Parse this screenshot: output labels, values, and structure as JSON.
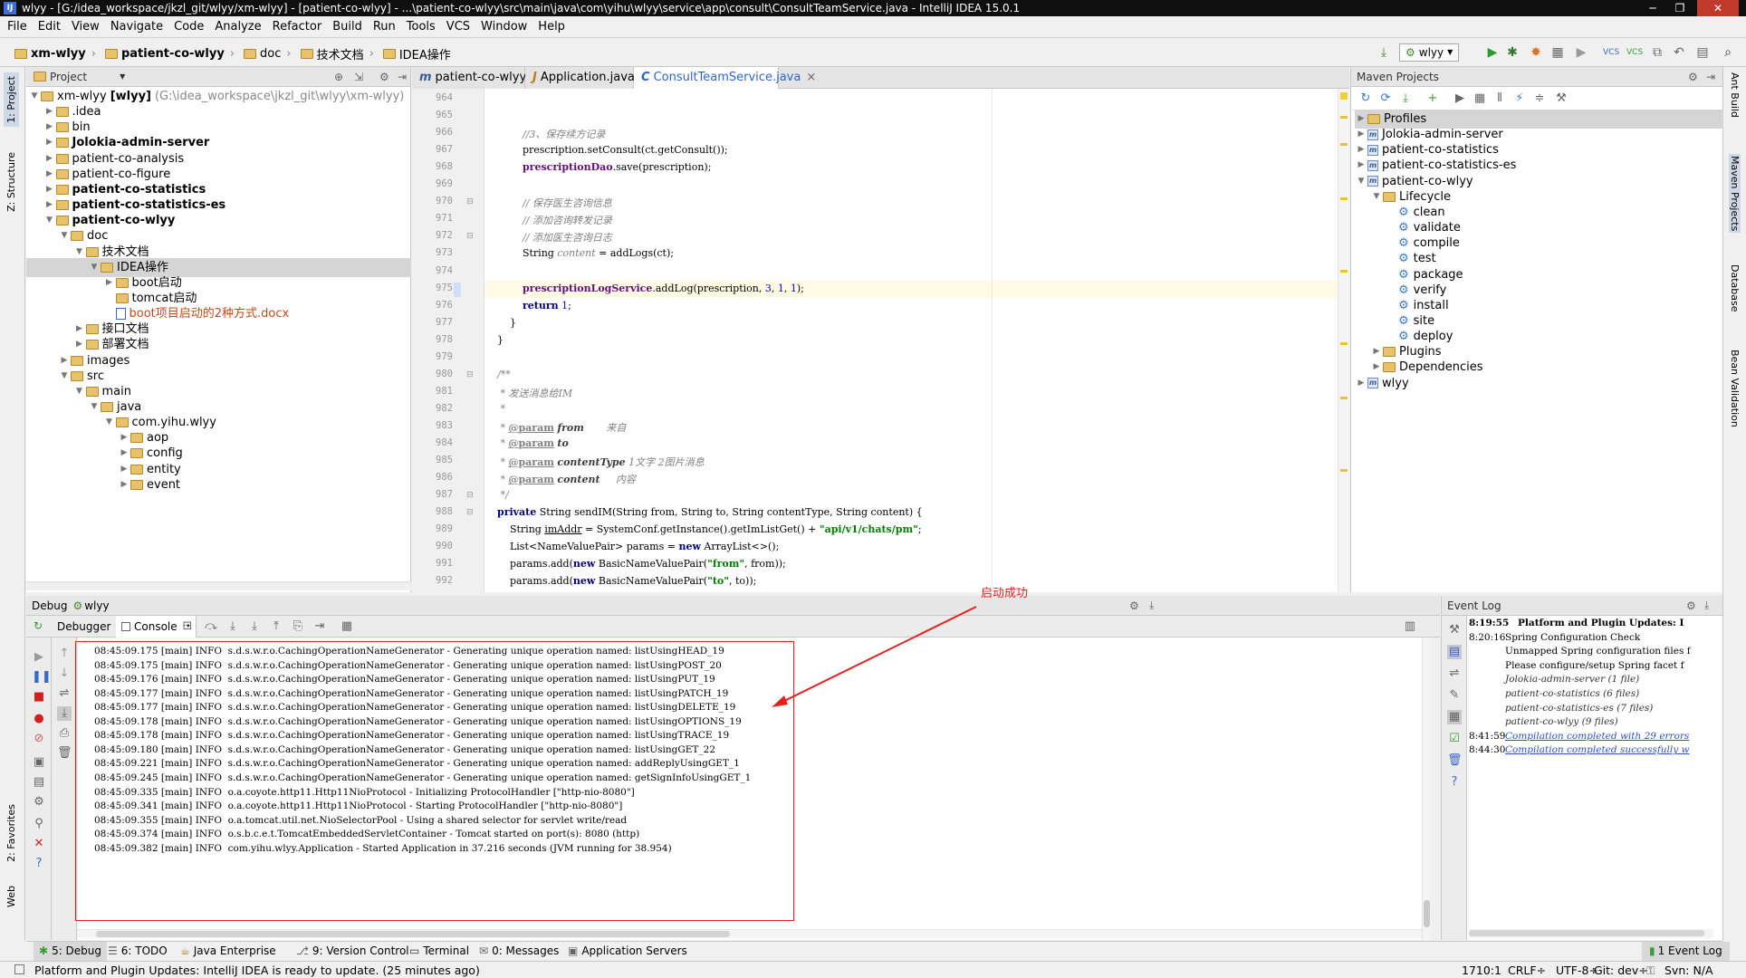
{
  "window": {
    "title": "wlyy - [G:/idea_workspace/jkzl_git/wlyy/xm-wlyy] - [patient-co-wlyy] - ...\\patient-co-wlyy\\src\\main\\java\\com\\yihu\\wlyy\\service\\app\\consult\\ConsultTeamService.java - IntelliJ IDEA 15.0.1",
    "logo": "IJ",
    "min": "─",
    "max": "❐",
    "close": "✕"
  },
  "menu": [
    "File",
    "Edit",
    "View",
    "Navigate",
    "Code",
    "Analyze",
    "Refactor",
    "Build",
    "Run",
    "Tools",
    "VCS",
    "Window",
    "Help"
  ],
  "breadcrumb": [
    "xm-wlyy",
    "patient-co-wlyy",
    "doc",
    "技术文档",
    "IDEA操作"
  ],
  "toolbar": {
    "run_config": "wlyy"
  },
  "left_strip": {
    "project": "1: Project",
    "structure": "Z: Structure",
    "favorites": "2: Favorites",
    "web": "Web"
  },
  "right_strip": {
    "ant": "Ant Build",
    "maven": "Maven Projects",
    "database": "Database",
    "bean": "Bean Validation"
  },
  "project_panel": {
    "title": "Project",
    "root": {
      "name": "xm-wlyy",
      "module": "[wlyy]",
      "path": "(G:\\idea_workspace\\jkzl_git\\wlyy\\xm-wlyy)"
    },
    "items": [
      {
        "label": ".idea",
        "depth": 1,
        "arrow": "▶",
        "bold": false
      },
      {
        "label": "bin",
        "depth": 1,
        "arrow": "▶",
        "bold": false
      },
      {
        "label": "Jolokia-admin-server",
        "depth": 1,
        "arrow": "▶",
        "bold": true
      },
      {
        "label": "patient-co-analysis",
        "depth": 1,
        "arrow": "▶",
        "bold": false
      },
      {
        "label": "patient-co-figure",
        "depth": 1,
        "arrow": "▶",
        "bold": false
      },
      {
        "label": "patient-co-statistics",
        "depth": 1,
        "arrow": "▶",
        "bold": true
      },
      {
        "label": "patient-co-statistics-es",
        "depth": 1,
        "arrow": "▶",
        "bold": true
      },
      {
        "label": "patient-co-wlyy",
        "depth": 1,
        "arrow": "▼",
        "bold": true
      },
      {
        "label": "doc",
        "depth": 2,
        "arrow": "▼",
        "bold": false
      },
      {
        "label": "技术文档",
        "depth": 3,
        "arrow": "▼",
        "bold": false
      },
      {
        "label": "IDEA操作",
        "depth": 4,
        "arrow": "▼",
        "bold": false,
        "selected": true
      },
      {
        "label": "boot启动",
        "depth": 5,
        "arrow": "▶",
        "bold": false
      },
      {
        "label": "tomcat启动",
        "depth": 5,
        "arrow": "",
        "bold": false
      },
      {
        "label": "boot项目启动的2种方式.docx",
        "depth": 5,
        "arrow": "",
        "bold": false,
        "file": true
      },
      {
        "label": "接口文档",
        "depth": 3,
        "arrow": "▶",
        "bold": false
      },
      {
        "label": "部署文档",
        "depth": 3,
        "arrow": "▶",
        "bold": false
      },
      {
        "label": "images",
        "depth": 2,
        "arrow": "▶",
        "bold": false
      },
      {
        "label": "src",
        "depth": 2,
        "arrow": "▼",
        "bold": false
      },
      {
        "label": "main",
        "depth": 3,
        "arrow": "▼",
        "bold": false
      },
      {
        "label": "java",
        "depth": 4,
        "arrow": "▼",
        "bold": false
      },
      {
        "label": "com.yihu.wlyy",
        "depth": 5,
        "arrow": "▼",
        "bold": false
      },
      {
        "label": "aop",
        "depth": 6,
        "arrow": "▶",
        "bold": false
      },
      {
        "label": "config",
        "depth": 6,
        "arrow": "▶",
        "bold": false
      },
      {
        "label": "entity",
        "depth": 6,
        "arrow": "▶",
        "bold": false
      },
      {
        "label": "event",
        "depth": 6,
        "arrow": "▶",
        "bold": false
      }
    ]
  },
  "editor_tabs": [
    {
      "label": "patient-co-wlyy",
      "icon": "m",
      "active": false
    },
    {
      "label": "Application.java",
      "icon": "J",
      "active": false
    },
    {
      "label": "ConsultTeamService.java",
      "icon": "C",
      "active": true
    }
  ],
  "code": {
    "line_numbers": [
      "964",
      "965",
      "966",
      "967",
      "968",
      "969",
      "970",
      "971",
      "972",
      "973",
      "974",
      "975",
      "976",
      "977",
      "978",
      "979",
      "980",
      "981",
      "982",
      "983",
      "984",
      "985",
      "986",
      "987",
      "988",
      "989",
      "990",
      "991",
      "992"
    ],
    "lines": [
      [],
      [],
      [
        [
          "            //3、保存续方记录",
          "cmt"
        ]
      ],
      [
        [
          "            prescription.setConsult(ct.getConsult());",
          ""
        ]
      ],
      [
        [
          "            ",
          ""
        ],
        [
          "prescriptionDao",
          "fld"
        ],
        [
          ".save(prescription);",
          ""
        ]
      ],
      [],
      [
        [
          "            // 保存医生咨询信息",
          "cmt"
        ]
      ],
      [
        [
          "            // 添加咨询转发记录",
          "cmt"
        ]
      ],
      [
        [
          "            // 添加医生咨询日志",
          "cmt"
        ]
      ],
      [
        [
          "            String ",
          ""
        ],
        [
          "content",
          "cmt"
        ],
        [
          " = addLogs(ct);",
          ""
        ]
      ],
      [],
      [
        [
          "            ",
          ""
        ],
        [
          "prescriptionLogService",
          "fld"
        ],
        [
          ".addLog(prescription, ",
          ""
        ],
        [
          "3",
          "num"
        ],
        [
          ", ",
          ""
        ],
        [
          "1",
          "num"
        ],
        [
          ", ",
          ""
        ],
        [
          "1",
          "num"
        ],
        [
          ");",
          ""
        ]
      ],
      [
        [
          "            ",
          ""
        ],
        [
          "return",
          "kw"
        ],
        [
          " ",
          ""
        ],
        [
          "1",
          "num"
        ],
        [
          ";",
          ""
        ]
      ],
      [
        [
          "        }",
          ""
        ]
      ],
      [
        [
          "    }",
          ""
        ]
      ],
      [],
      [
        [
          "    /**",
          "doc"
        ]
      ],
      [
        [
          "     * 发送消息给IM",
          "doc"
        ]
      ],
      [
        [
          "     *",
          "doc"
        ]
      ],
      [
        [
          "     * ",
          "doc"
        ],
        [
          "@param",
          "doctag"
        ],
        [
          " ",
          ""
        ],
        [
          "from",
          "docparm"
        ],
        [
          "       来自",
          "doc"
        ]
      ],
      [
        [
          "     * ",
          "doc"
        ],
        [
          "@param",
          "doctag"
        ],
        [
          " ",
          ""
        ],
        [
          "to",
          "docparm"
        ]
      ],
      [
        [
          "     * ",
          "doc"
        ],
        [
          "@param",
          "doctag"
        ],
        [
          " ",
          ""
        ],
        [
          "contentType",
          "docparm"
        ],
        [
          " 1文字 2图片消息",
          "doc"
        ]
      ],
      [
        [
          "     * ",
          "doc"
        ],
        [
          "@param",
          "doctag"
        ],
        [
          " ",
          ""
        ],
        [
          "content",
          "docparm"
        ],
        [
          "     内容",
          "doc"
        ]
      ],
      [
        [
          "     */",
          "doc"
        ]
      ],
      [
        [
          "    ",
          ""
        ],
        [
          "private",
          "kw"
        ],
        [
          " String sendIM(String from, String to, String contentType, String content) {",
          ""
        ]
      ],
      [
        [
          "        String ",
          ""
        ],
        [
          "imAddr",
          "u"
        ],
        [
          " = SystemConf.getInstance().getImListGet() + ",
          ""
        ],
        [
          "\"api/v1/chats/pm\"",
          "str"
        ],
        [
          ";",
          ""
        ]
      ],
      [
        [
          "        List<NameValuePair> params = ",
          ""
        ],
        [
          "new",
          "kw"
        ],
        [
          " ArrayList<>();",
          ""
        ]
      ],
      [
        [
          "        params.add(",
          ""
        ],
        [
          "new",
          "kw"
        ],
        [
          " BasicNameValuePair(",
          ""
        ],
        [
          "\"from\"",
          "str"
        ],
        [
          ", from));",
          ""
        ]
      ],
      [
        [
          "        params.add(",
          ""
        ],
        [
          "new",
          "kw"
        ],
        [
          " BasicNameValuePair(",
          ""
        ],
        [
          "\"to\"",
          "str"
        ],
        [
          ", to));",
          ""
        ]
      ]
    ]
  },
  "maven_panel": {
    "title": "Maven Projects",
    "items": [
      {
        "label": "Profiles",
        "depth": 0,
        "arrow": "▶",
        "type": "folder"
      },
      {
        "label": "Jolokia-admin-server",
        "depth": 0,
        "arrow": "▶",
        "type": "mvn"
      },
      {
        "label": "patient-co-statistics",
        "depth": 0,
        "arrow": "▶",
        "type": "mvn"
      },
      {
        "label": "patient-co-statistics-es",
        "depth": 0,
        "arrow": "▶",
        "type": "mvn"
      },
      {
        "label": "patient-co-wlyy",
        "depth": 0,
        "arrow": "▼",
        "type": "mvn"
      },
      {
        "label": "Lifecycle",
        "depth": 1,
        "arrow": "▼",
        "type": "folder"
      },
      {
        "label": "clean",
        "depth": 2,
        "arrow": "",
        "type": "gear"
      },
      {
        "label": "validate",
        "depth": 2,
        "arrow": "",
        "type": "gear"
      },
      {
        "label": "compile",
        "depth": 2,
        "arrow": "",
        "type": "gear"
      },
      {
        "label": "test",
        "depth": 2,
        "arrow": "",
        "type": "gear"
      },
      {
        "label": "package",
        "depth": 2,
        "arrow": "",
        "type": "gear"
      },
      {
        "label": "verify",
        "depth": 2,
        "arrow": "",
        "type": "gear"
      },
      {
        "label": "install",
        "depth": 2,
        "arrow": "",
        "type": "gear"
      },
      {
        "label": "site",
        "depth": 2,
        "arrow": "",
        "type": "gear"
      },
      {
        "label": "deploy",
        "depth": 2,
        "arrow": "",
        "type": "gear"
      },
      {
        "label": "Plugins",
        "depth": 1,
        "arrow": "▶",
        "type": "folder"
      },
      {
        "label": "Dependencies",
        "depth": 1,
        "arrow": "▶",
        "type": "folder"
      },
      {
        "label": "wlyy",
        "depth": 0,
        "arrow": "▶",
        "type": "mvn"
      }
    ]
  },
  "debug_panel": {
    "title": "Debug",
    "config": "wlyy",
    "tabs": {
      "debugger": "Debugger",
      "console": "Console"
    },
    "annotation": "启动成功",
    "log": [
      "08:45:09.175 [main] INFO  s.d.s.w.r.o.CachingOperationNameGenerator - Generating unique operation named: listUsingHEAD_19",
      "08:45:09.175 [main] INFO  s.d.s.w.r.o.CachingOperationNameGenerator - Generating unique operation named: listUsingPOST_20",
      "08:45:09.176 [main] INFO  s.d.s.w.r.o.CachingOperationNameGenerator - Generating unique operation named: listUsingPUT_19",
      "08:45:09.177 [main] INFO  s.d.s.w.r.o.CachingOperationNameGenerator - Generating unique operation named: listUsingPATCH_19",
      "08:45:09.177 [main] INFO  s.d.s.w.r.o.CachingOperationNameGenerator - Generating unique operation named: listUsingDELETE_19",
      "08:45:09.178 [main] INFO  s.d.s.w.r.o.CachingOperationNameGenerator - Generating unique operation named: listUsingOPTIONS_19",
      "08:45:09.178 [main] INFO  s.d.s.w.r.o.CachingOperationNameGenerator - Generating unique operation named: listUsingTRACE_19",
      "08:45:09.180 [main] INFO  s.d.s.w.r.o.CachingOperationNameGenerator - Generating unique operation named: listUsingGET_22",
      "08:45:09.221 [main] INFO  s.d.s.w.r.o.CachingOperationNameGenerator - Generating unique operation named: addReplyUsingGET_1",
      "08:45:09.245 [main] INFO  s.d.s.w.r.o.CachingOperationNameGenerator - Generating unique operation named: getSignInfoUsingGET_1",
      "08:45:09.335 [main] INFO  o.a.coyote.http11.Http11NioProtocol - Initializing ProtocolHandler [\"http-nio-8080\"]",
      "08:45:09.341 [main] INFO  o.a.coyote.http11.Http11NioProtocol - Starting ProtocolHandler [\"http-nio-8080\"]",
      "08:45:09.355 [main] INFO  o.a.tomcat.util.net.NioSelectorPool - Using a shared selector for servlet write/read",
      "08:45:09.374 [main] INFO  o.s.b.c.e.t.TomcatEmbeddedServletContainer - Tomcat started on port(s): 8080 (http)",
      "08:45:09.382 [main] INFO  com.yihu.wlyy.Application - Started Application in 37.216 seconds (JVM running for 38.954)"
    ]
  },
  "event_log": {
    "title": "Event Log",
    "entries": [
      {
        "time": "8:19:55",
        "text": "Platform and Plugin Updates: I",
        "style": "bold"
      },
      {
        "time": "8:20:16",
        "text": "Spring Configuration Check",
        "style": "normal"
      },
      {
        "time": "",
        "text": "Unmapped Spring configuration files f",
        "style": "normal"
      },
      {
        "time": "",
        "text": "Please configure/setup Spring facet f",
        "style": "normal"
      },
      {
        "time": "",
        "text": "Jolokia-admin-server (1 file)",
        "style": "italic"
      },
      {
        "time": "",
        "text": "patient-co-statistics (6 files)",
        "style": "italic"
      },
      {
        "time": "",
        "text": "patient-co-statistics-es (7 files)",
        "style": "italic"
      },
      {
        "time": "",
        "text": "patient-co-wlyy (9 files)",
        "style": "italic"
      },
      {
        "time": "8:41:59",
        "text": "Compilation completed with 29 errors",
        "style": "link"
      },
      {
        "time": "8:44:30",
        "text": "Compilation completed successfully w",
        "style": "link"
      }
    ]
  },
  "bottom_tabs": [
    {
      "label": "5: Debug",
      "icon": "bug-icon"
    },
    {
      "label": "6: TODO",
      "icon": "todo-icon"
    },
    {
      "label": "Java Enterprise",
      "icon": "java-enterprise-icon"
    },
    {
      "label": "9: Version Control",
      "icon": "vcs-icon"
    },
    {
      "label": "Terminal",
      "icon": "terminal-icon"
    },
    {
      "label": "0: Messages",
      "icon": "messages-icon"
    },
    {
      "label": "Application Servers",
      "icon": "servers-icon"
    }
  ],
  "event_log_tab": "1 Event Log",
  "status": {
    "message": "Platform and Plugin Updates: IntelliJ IDEA is ready to update. (25 minutes ago)",
    "position": "1710:1",
    "line_sep": "CRLF÷",
    "encoding": "UTF-8÷",
    "git": "Git: dev÷",
    "svn": "Svn: N/A"
  },
  "colors": {
    "accent": "#2f65ca",
    "selection": "#d5d5d5",
    "highlight_line": "#fffae3",
    "red_box": "#e81f1f"
  }
}
